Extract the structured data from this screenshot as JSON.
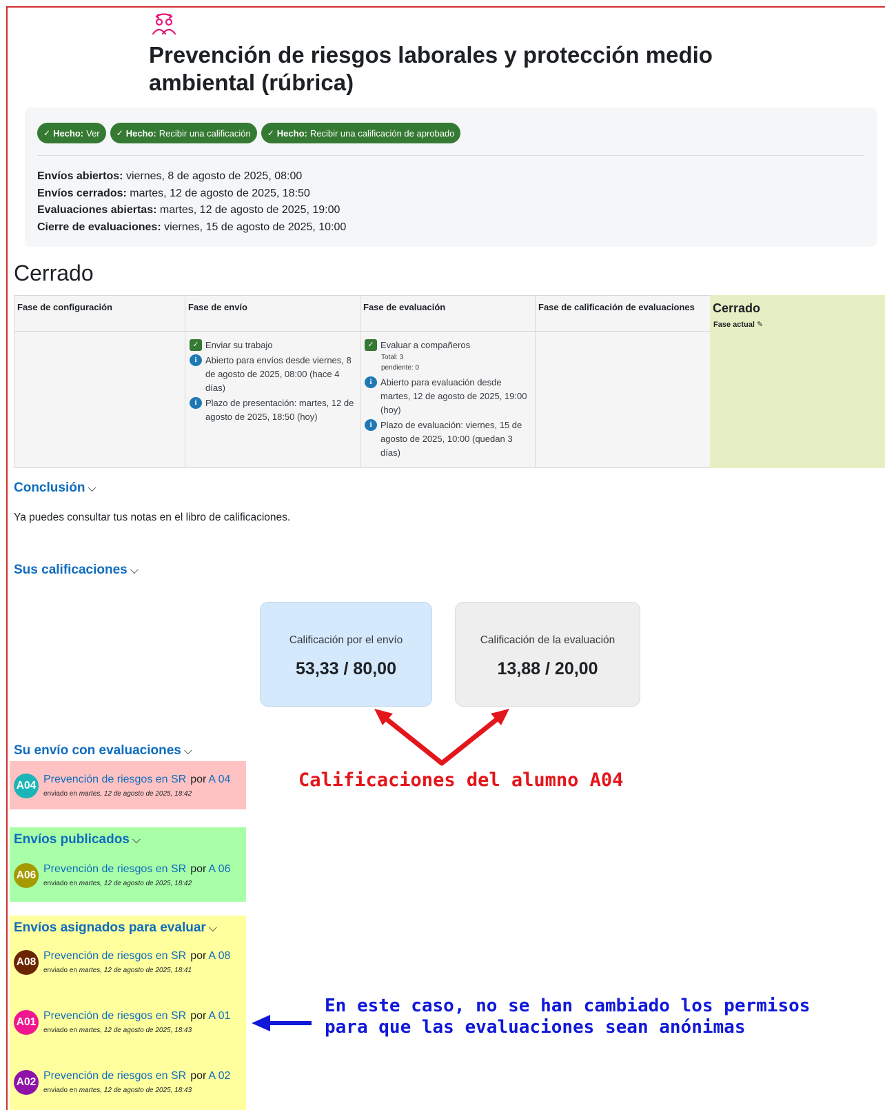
{
  "title": "Prevención de riesgos laborales y protección medio ambiental (rúbrica)",
  "icon": "workshop-users-icon",
  "completion": [
    {
      "label": "Hecho:",
      "text": "Ver"
    },
    {
      "label": "Hecho:",
      "text": "Recibir una calificación"
    },
    {
      "label": "Hecho:",
      "text": "Recibir una calificación de aprobado"
    }
  ],
  "dates": [
    {
      "label": "Envíos abiertos:",
      "value": "viernes, 8 de agosto de 2025, 08:00"
    },
    {
      "label": "Envíos cerrados:",
      "value": "martes, 12 de agosto de 2025, 18:50"
    },
    {
      "label": "Evaluaciones abiertas:",
      "value": "martes, 12 de agosto de 2025, 19:00"
    },
    {
      "label": "Cierre de evaluaciones:",
      "value": "viernes, 15 de agosto de 2025, 10:00"
    }
  ],
  "phase_heading": "Cerrado",
  "phases": {
    "setup": {
      "title": "Fase de configuración"
    },
    "submission": {
      "title": "Fase de envío",
      "tasks": [
        {
          "type": "done",
          "text": "Enviar su trabajo"
        },
        {
          "type": "info",
          "text": "Abierto para envíos desde viernes, 8 de agosto de 2025, 08:00 (hace 4 días)"
        },
        {
          "type": "info",
          "text": "Plazo de presentación: martes, 12 de agosto de 2025, 18:50 (hoy)"
        }
      ]
    },
    "assessment": {
      "title": "Fase de evaluación",
      "tasks": [
        {
          "type": "done",
          "text": "Evaluar a compañeros",
          "total": "Total: 3",
          "pending": "pendiente: 0"
        },
        {
          "type": "info",
          "text": "Abierto para evaluación desde martes, 12 de agosto de 2025, 19:00 (hoy)"
        },
        {
          "type": "info",
          "text": "Plazo de evaluación: viernes, 15 de agosto de 2025, 10:00 (quedan 3 días)"
        }
      ]
    },
    "evaluation": {
      "title": "Fase de calificación de evaluaciones"
    },
    "closed": {
      "title": "Cerrado",
      "current_label": "Fase actual"
    }
  },
  "conclusion": {
    "heading": "Conclusión",
    "text": "Ya puedes consultar tus notas en el libro de calificaciones."
  },
  "grades": {
    "heading": "Sus calificaciones",
    "submission": {
      "label": "Calificación por el envío",
      "value": "53,33 / 80,00"
    },
    "assessment": {
      "label": "Calificación de la evaluación",
      "value": "13,88 / 20,00"
    }
  },
  "own_submission": {
    "heading": "Su envío con evaluaciones",
    "items": [
      {
        "avatar": "A04",
        "avatar_color": "#1bb5b8",
        "title": "Prevención de riesgos en SR",
        "by": "por",
        "author": "A 04",
        "sent": "enviado en",
        "date": "martes, 12 de agosto de 2025, 18:42"
      }
    ]
  },
  "published": {
    "heading": "Envíos publicados",
    "items": [
      {
        "avatar": "A06",
        "avatar_color": "#a59a00",
        "title": "Prevención de riesgos en SR",
        "by": "por",
        "author": "A 06",
        "sent": "enviado en",
        "date": "martes, 12 de agosto de 2025, 18:42"
      }
    ]
  },
  "assigned": {
    "heading": "Envíos asignados para evaluar",
    "items": [
      {
        "avatar": "A08",
        "avatar_color": "#6b2400",
        "title": "Prevención de riesgos en SR",
        "by": "por",
        "author": "A 08",
        "sent": "enviado en",
        "date": "martes, 12 de agosto de 2025, 18:41"
      },
      {
        "avatar": "A01",
        "avatar_color": "#f0168f",
        "title": "Prevención de riesgos en SR",
        "by": "por",
        "author": "A 01",
        "sent": "enviado en",
        "date": "martes, 12 de agosto de 2025, 18:43"
      },
      {
        "avatar": "A02",
        "avatar_color": "#8e12a8",
        "title": "Prevención de riesgos en SR",
        "by": "por",
        "author": "A 02",
        "sent": "enviado en",
        "date": "martes, 12 de agosto de 2025, 18:43"
      }
    ]
  },
  "annotations": {
    "red": "Calificaciones del alumno A04",
    "blue_line1": "En este caso, no se han cambiado los permisos",
    "blue_line2": "para que las evaluaciones sean anónimas",
    "red_color": "#e3161b",
    "blue_color": "#1018d9"
  },
  "colors": {
    "link": "#0f6cbf",
    "badge_green": "#357a32",
    "current_phase": "#e6efc4"
  }
}
